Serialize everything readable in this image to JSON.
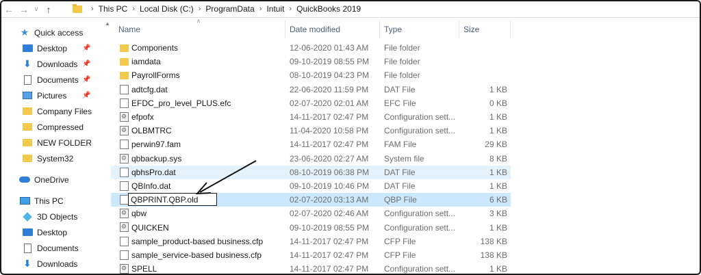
{
  "address_bar": {
    "crumbs": [
      "This PC",
      "Local Disk (C:)",
      "ProgramData",
      "Intuit",
      "QuickBooks 2019"
    ]
  },
  "nav": {
    "quick_access": "Quick access",
    "pinned": [
      {
        "label": "Desktop",
        "icon": "desktop-icon"
      },
      {
        "label": "Downloads",
        "icon": "downloads-icon"
      },
      {
        "label": "Documents",
        "icon": "documents-icon"
      },
      {
        "label": "Pictures",
        "icon": "pictures-icon"
      }
    ],
    "folders": [
      "Company Files",
      "Compressed",
      "NEW FOLDER",
      "System32"
    ],
    "onedrive": "OneDrive",
    "this_pc": "This PC",
    "pc_items": [
      {
        "label": "3D Objects",
        "icon": "3d-objects-icon"
      },
      {
        "label": "Desktop",
        "icon": "desktop-icon"
      },
      {
        "label": "Documents",
        "icon": "documents-icon"
      },
      {
        "label": "Downloads",
        "icon": "downloads-icon"
      }
    ]
  },
  "columns": {
    "name": "Name",
    "date": "Date modified",
    "type": "Type",
    "size": "Size"
  },
  "files": [
    {
      "name": "Components",
      "date": "12-06-2020 01:43 AM",
      "type": "File folder",
      "size": "",
      "icon": "folder"
    },
    {
      "name": "iamdata",
      "date": "09-10-2019 08:55 PM",
      "type": "File folder",
      "size": "",
      "icon": "folder"
    },
    {
      "name": "PayrollForms",
      "date": "08-10-2019 04:23 PM",
      "type": "File folder",
      "size": "",
      "icon": "folder"
    },
    {
      "name": "adtcfg.dat",
      "date": "22-06-2020 11:59 PM",
      "type": "DAT File",
      "size": "1 KB",
      "icon": "file"
    },
    {
      "name": "EFDC_pro_level_PLUS.efc",
      "date": "02-07-2020 02:01 AM",
      "type": "EFC File",
      "size": "0 KB",
      "icon": "file"
    },
    {
      "name": "efpofx",
      "date": "14-11-2017 02:47 PM",
      "type": "Configuration sett...",
      "size": "1 KB",
      "icon": "cfg"
    },
    {
      "name": "OLBMTRC",
      "date": "11-04-2020 10:58 PM",
      "type": "Configuration sett...",
      "size": "1 KB",
      "icon": "cfg"
    },
    {
      "name": "perwin97.fam",
      "date": "14-11-2017 02:47 PM",
      "type": "FAM File",
      "size": "29 KB",
      "icon": "file"
    },
    {
      "name": "qbbackup.sys",
      "date": "23-06-2020 02:27 AM",
      "type": "System file",
      "size": "8 KB",
      "icon": "sys"
    },
    {
      "name": "qbhsPro.dat",
      "date": "08-10-2019 06:38 PM",
      "type": "DAT File",
      "size": "1 KB",
      "icon": "file",
      "state": "hover"
    },
    {
      "name": "QBInfo.dat",
      "date": "09-10-2019 10:46 PM",
      "type": "DAT File",
      "size": "1 KB",
      "icon": "file"
    },
    {
      "name": "QBPRINT.QBP.old",
      "date": "02-07-2020 03:13 AM",
      "type": "QBP File",
      "size": "6 KB",
      "icon": "file",
      "state": "rename"
    },
    {
      "name": "qbw",
      "date": "02-07-2020 02:46 AM",
      "type": "Configuration sett...",
      "size": "3 KB",
      "icon": "cfg"
    },
    {
      "name": "QUICKEN",
      "date": "09-10-2019 08:55 PM",
      "type": "Configuration sett...",
      "size": "1 KB",
      "icon": "cfg"
    },
    {
      "name": "sample_product-based business.cfp",
      "date": "14-11-2017 02:47 PM",
      "type": "CFP File",
      "size": "138 KB",
      "icon": "file"
    },
    {
      "name": "sample_service-based business.cfp",
      "date": "14-11-2017 02:47 PM",
      "type": "CFP File",
      "size": "138 KB",
      "icon": "file"
    },
    {
      "name": "SPELL",
      "date": "14-11-2017 02:47 PM",
      "type": "Configuration sett...",
      "size": "1 KB",
      "icon": "cfg"
    }
  ]
}
